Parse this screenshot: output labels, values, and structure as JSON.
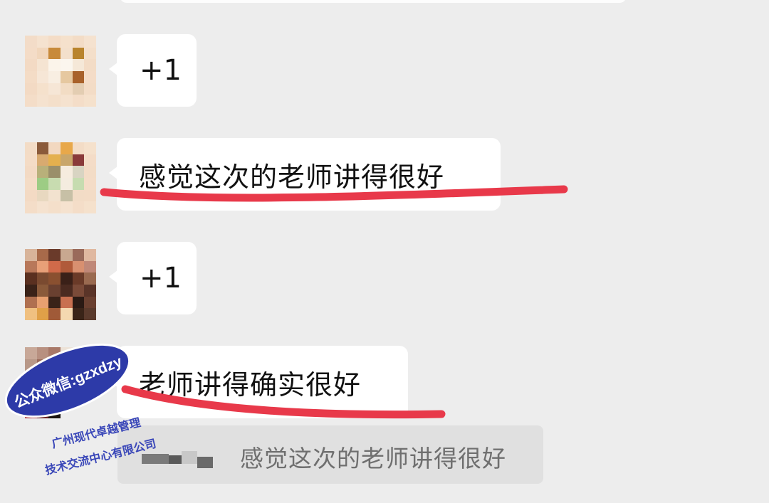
{
  "messages": [
    {
      "text": "+1"
    },
    {
      "text": "感觉这次的老师讲得很好"
    },
    {
      "text": "+1"
    },
    {
      "text": "老师讲得确实很好"
    }
  ],
  "quote": {
    "text": "感觉这次的老师讲得很好"
  },
  "watermark": {
    "badge": "公众微信:gzxdzy",
    "line1": "广州现代卓越管理",
    "line2": "技术交流中心有限公司"
  },
  "colors": {
    "background": "#ededed",
    "bubble": "#ffffff",
    "underline": "#e8394a",
    "watermark_blue": "#2d3aa8"
  }
}
